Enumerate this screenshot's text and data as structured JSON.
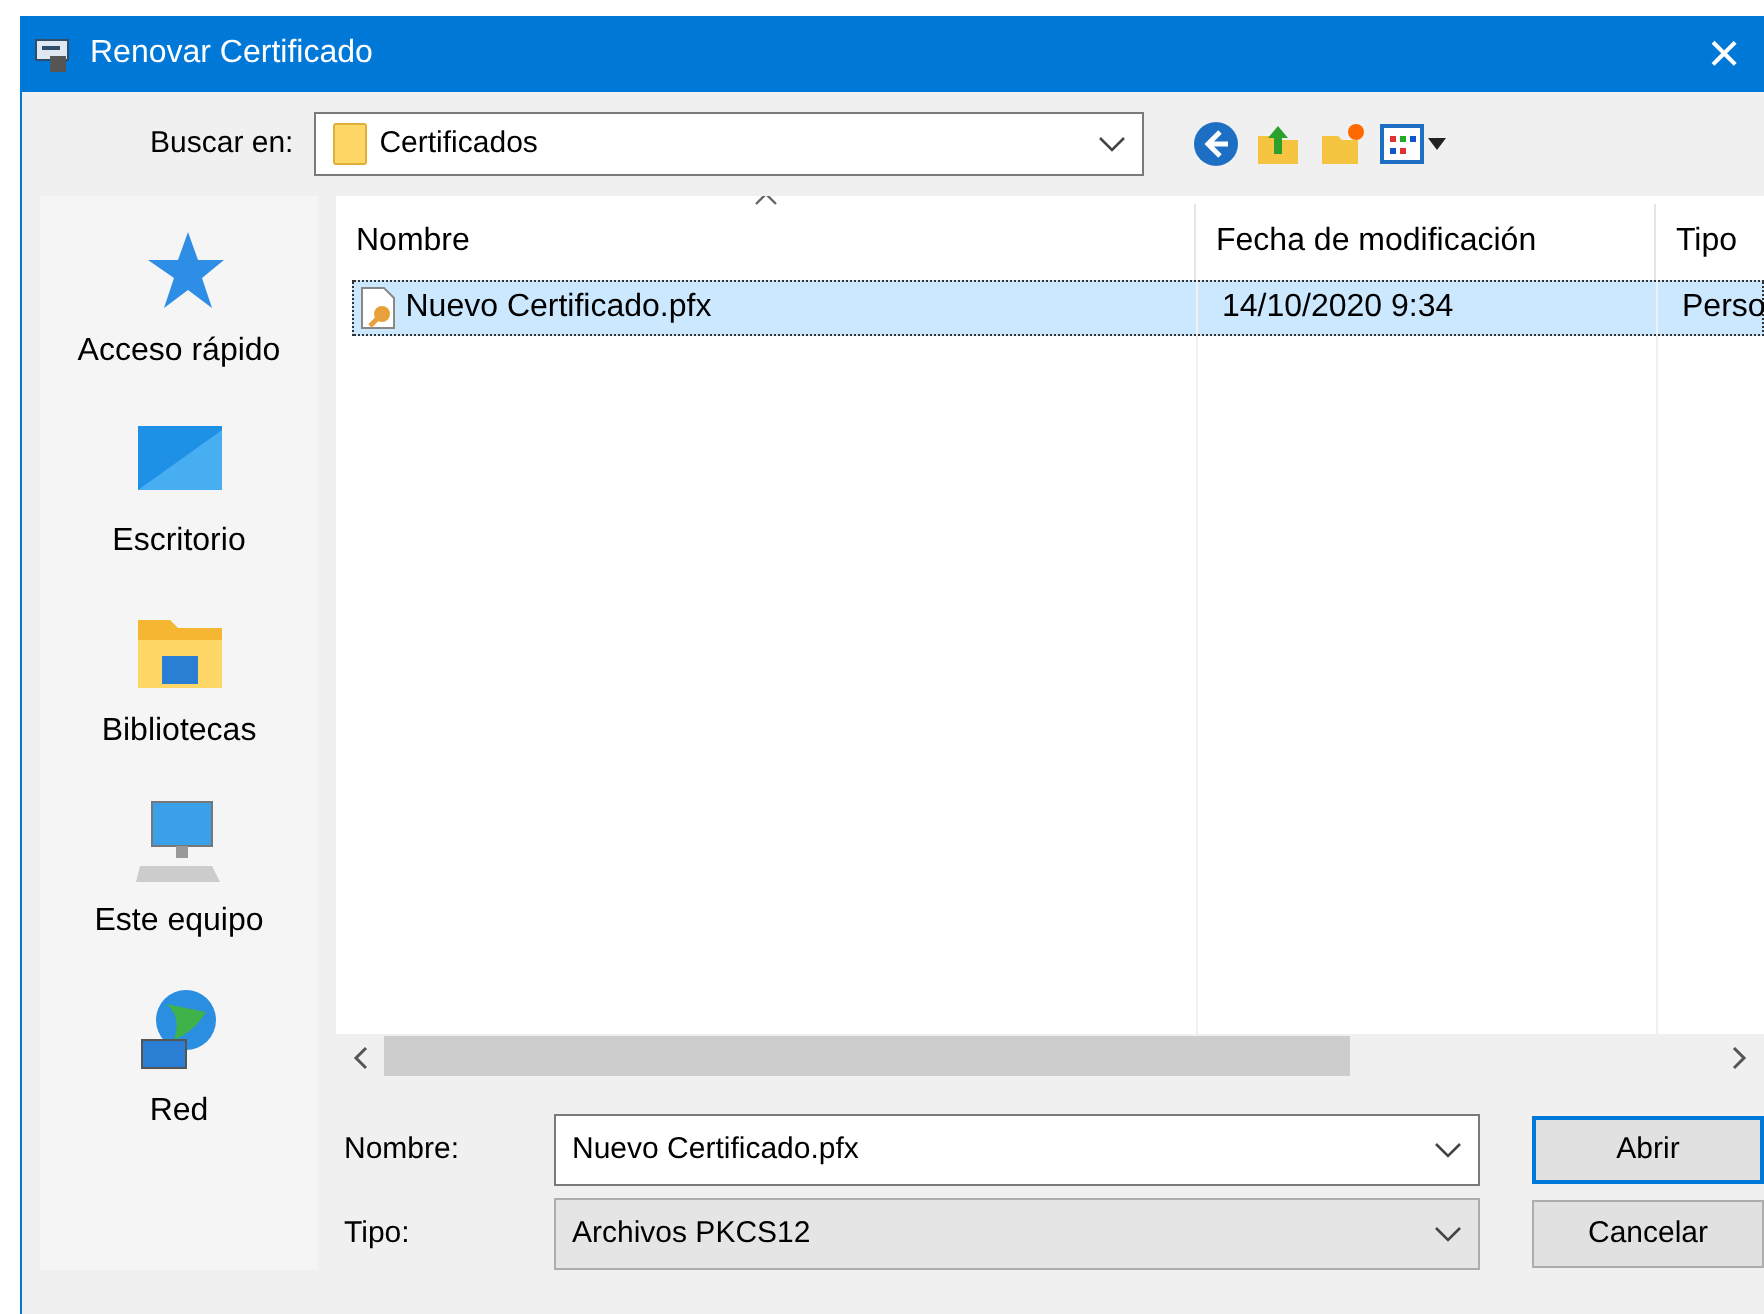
{
  "window": {
    "title": "Renovar Certificado",
    "close": "×"
  },
  "look_in": {
    "label": "Buscar en:",
    "value": "Certificados"
  },
  "places": [
    {
      "label": "Acceso rápido",
      "kind": "star"
    },
    {
      "label": "Escritorio",
      "kind": "desktop"
    },
    {
      "label": "Bibliotecas",
      "kind": "library"
    },
    {
      "label": "Este equipo",
      "kind": "computer"
    },
    {
      "label": "Red",
      "kind": "network"
    }
  ],
  "table": {
    "columns": [
      {
        "label": "Nombre",
        "sorted": true
      },
      {
        "label": "Fecha de modificación",
        "sorted": false
      },
      {
        "label": "Tipo",
        "sorted": false
      }
    ],
    "rows": [
      {
        "cells": [
          "Nuevo Certificado.pfx",
          "14/10/2020 9:34",
          "Perso"
        ],
        "selected": true
      }
    ]
  },
  "file_name": {
    "label": "Nombre:",
    "value": "Nuevo Certificado.pfx"
  },
  "file_type": {
    "label": "Tipo:",
    "value": "Archivos PKCS12"
  },
  "buttons": [
    {
      "label": "Abrir",
      "default": true
    },
    {
      "label": "Cancelar",
      "default": false
    }
  ]
}
